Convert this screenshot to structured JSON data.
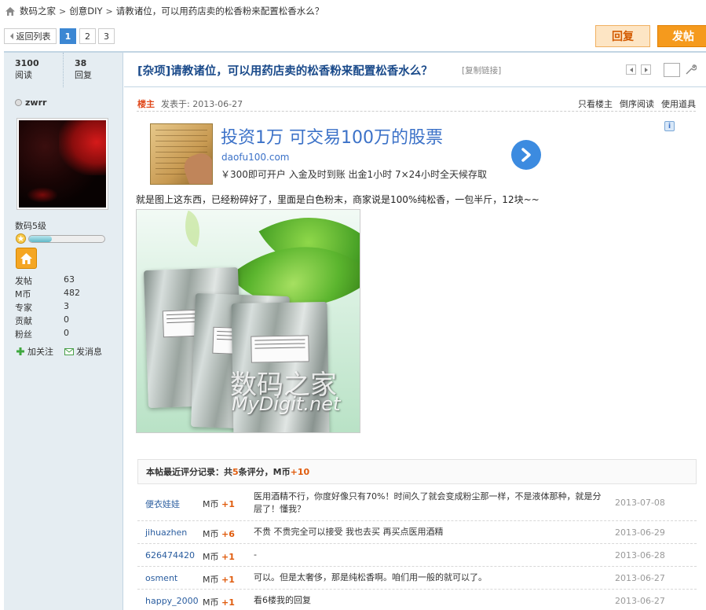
{
  "breadcrumb": {
    "home": "数码之家",
    "items": [
      "创意DIY",
      "请教诸位，可以用药店卖的松香粉来配置松香水么？"
    ]
  },
  "pager": {
    "back": "返回列表",
    "pages": [
      "1",
      "2",
      "3"
    ],
    "current": "1"
  },
  "actions": {
    "reply": "回复",
    "post": "发帖"
  },
  "stats": {
    "views": "3100",
    "views_label": "阅读",
    "replies": "38",
    "replies_label": "回复"
  },
  "thread": {
    "title": "[杂项]请教诸位，可以用药店卖的松香粉来配置松香水么？",
    "copy_link": "[复制链接]"
  },
  "user": {
    "name": "zwrr",
    "level": "数码5级",
    "level_progress": 0.3,
    "stats": [
      {
        "label": "发帖",
        "value": "63"
      },
      {
        "label": "M币",
        "value": "482"
      },
      {
        "label": "专家",
        "value": "3"
      },
      {
        "label": "贡献",
        "value": "0"
      },
      {
        "label": "粉丝",
        "value": "0"
      }
    ],
    "follow": "加关注",
    "message": "发消息"
  },
  "post": {
    "louzhu": "楼主",
    "posted": "发表于: 2013-06-27",
    "options": [
      "只看楼主",
      "倒序阅读",
      "使用道具"
    ],
    "body": "就是图上这东西，已经粉碎好了，里面是白色粉末，商家说是100%纯松香，一包半斤，12块~~"
  },
  "ad": {
    "title": "投资1万 可交易100万的股票",
    "url": "daofu100.com",
    "desc": "￥300即可开户 入金及时到账 出金1小时 7×24小时全天候存取",
    "info": "i"
  },
  "watermark": {
    "cn": "数码之家",
    "en": "MyDigit.net"
  },
  "ratings": {
    "head_pre": "本帖最近评分记录：共",
    "count": "5",
    "head_mid": "条评分，M币",
    "total": "+10",
    "rows": [
      {
        "user": "便衣娃娃",
        "unit": "M币",
        "score": "+1",
        "comment": "医用酒精不行，你度好像只有70%！时间久了就会变成粉尘那一样，不是液体那种，就是分层了！懂我？",
        "date": "2013-07-08"
      },
      {
        "user": "jihuazhen",
        "unit": "M币",
        "score": "+6",
        "comment": "不贵 不贵完全可以接受 我也去买 再买点医用酒精",
        "date": "2013-06-29"
      },
      {
        "user": "626474420",
        "unit": "M币",
        "score": "+1",
        "comment": "-",
        "date": "2013-06-28"
      },
      {
        "user": "osment",
        "unit": "M币",
        "score": "+1",
        "comment": "可以。但是太奢侈，那是纯松香啊。咱们用一般的就可以了。",
        "date": "2013-06-27"
      },
      {
        "user": "happy_2000",
        "unit": "M币",
        "score": "+1",
        "comment": "看6楼我的回复",
        "date": "2013-06-27"
      }
    ]
  },
  "colors": {
    "accent": "#3c87d3",
    "title": "#1a4a8a",
    "orange": "#f59a1d",
    "sidebar": "#e5edf2"
  }
}
